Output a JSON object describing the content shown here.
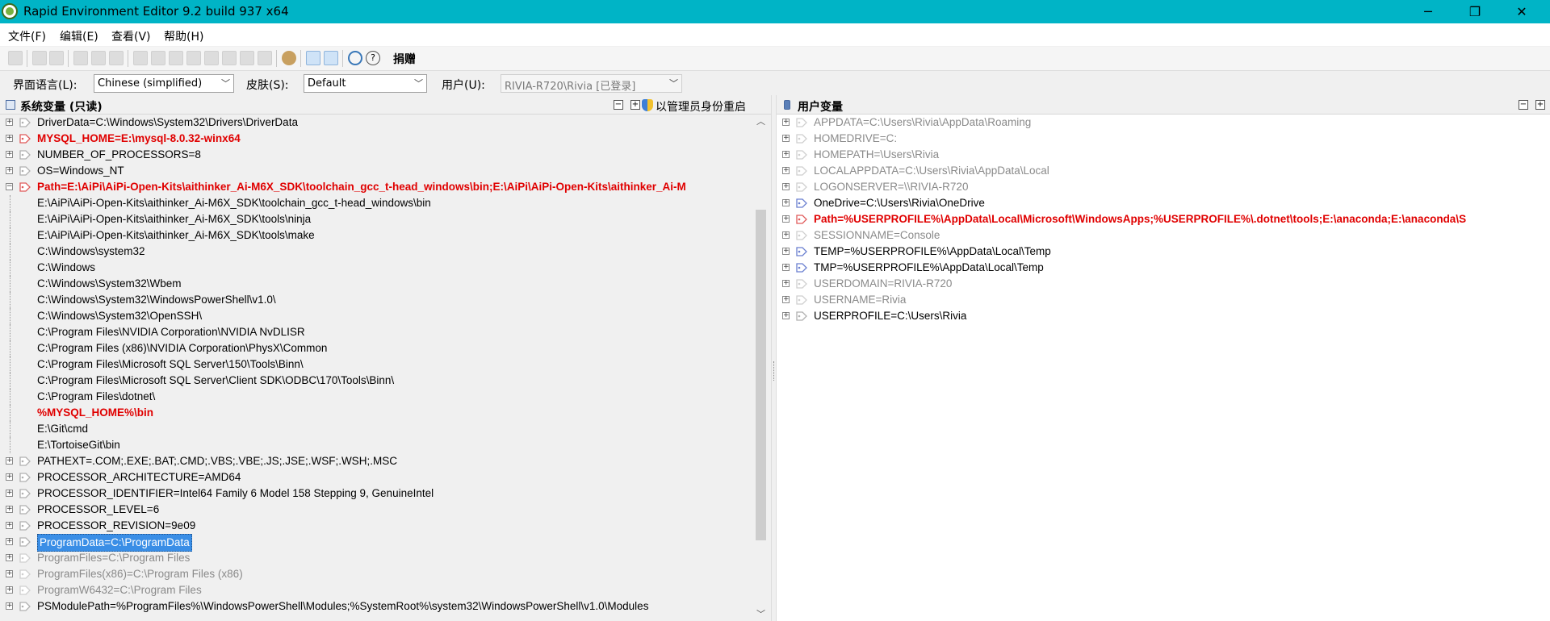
{
  "window": {
    "title": "Rapid Environment Editor 9.2 build 937 x64",
    "controls": [
      "─",
      "❐",
      "✕"
    ]
  },
  "menu": [
    "文件(F)",
    "编辑(E)",
    "查看(V)",
    "帮助(H)"
  ],
  "toolbar": {
    "donate_label": "捐赠"
  },
  "options": {
    "language_label": "界面语言(L):",
    "language_value": "Chinese (simplified)",
    "skin_label": "皮肤(S):",
    "skin_value": "Default",
    "user_label": "用户(U):",
    "user_value": "RIVIA-R720\\Rivia [已登录]"
  },
  "system_panel": {
    "title": "系统变量 (只读)",
    "admin_restart": "以管理员身份重启",
    "rows": [
      {
        "text": "DriverData=C:\\Windows\\System32\\Drivers\\DriverData",
        "level": 0,
        "style": "normal",
        "icon": "tag"
      },
      {
        "text": "MYSQL_HOME=E:\\mysql-8.0.32-winx64",
        "level": 0,
        "style": "red",
        "icon": "tag-red"
      },
      {
        "text": "NUMBER_OF_PROCESSORS=8",
        "level": 0,
        "style": "normal",
        "icon": "tag"
      },
      {
        "text": "OS=Windows_NT",
        "level": 0,
        "style": "normal",
        "icon": "tag"
      },
      {
        "text": "Path=E:\\AiPi\\AiPi-Open-Kits\\aithinker_Ai-M6X_SDK\\toolchain_gcc_t-head_windows\\bin;E:\\AiPi\\AiPi-Open-Kits\\aithinker_Ai-M",
        "level": 0,
        "style": "red",
        "icon": "tag-red",
        "expanded": true
      },
      {
        "text": "E:\\AiPi\\AiPi-Open-Kits\\aithinker_Ai-M6X_SDK\\toolchain_gcc_t-head_windows\\bin",
        "level": 1,
        "style": "normal"
      },
      {
        "text": "E:\\AiPi\\AiPi-Open-Kits\\aithinker_Ai-M6X_SDK\\tools\\ninja",
        "level": 1,
        "style": "normal"
      },
      {
        "text": "E:\\AiPi\\AiPi-Open-Kits\\aithinker_Ai-M6X_SDK\\tools\\make",
        "level": 1,
        "style": "normal"
      },
      {
        "text": "C:\\Windows\\system32",
        "level": 1,
        "style": "normal"
      },
      {
        "text": "C:\\Windows",
        "level": 1,
        "style": "normal"
      },
      {
        "text": "C:\\Windows\\System32\\Wbem",
        "level": 1,
        "style": "normal"
      },
      {
        "text": "C:\\Windows\\System32\\WindowsPowerShell\\v1.0\\",
        "level": 1,
        "style": "normal"
      },
      {
        "text": "C:\\Windows\\System32\\OpenSSH\\",
        "level": 1,
        "style": "normal"
      },
      {
        "text": "C:\\Program Files\\NVIDIA Corporation\\NVIDIA NvDLISR",
        "level": 1,
        "style": "normal"
      },
      {
        "text": "C:\\Program Files (x86)\\NVIDIA Corporation\\PhysX\\Common",
        "level": 1,
        "style": "normal"
      },
      {
        "text": "C:\\Program Files\\Microsoft SQL Server\\150\\Tools\\Binn\\",
        "level": 1,
        "style": "normal"
      },
      {
        "text": "C:\\Program Files\\Microsoft SQL Server\\Client SDK\\ODBC\\170\\Tools\\Binn\\",
        "level": 1,
        "style": "normal"
      },
      {
        "text": "C:\\Program Files\\dotnet\\",
        "level": 1,
        "style": "normal"
      },
      {
        "text": "%MYSQL_HOME%\\bin",
        "level": 1,
        "style": "red"
      },
      {
        "text": "E:\\Git\\cmd",
        "level": 1,
        "style": "normal"
      },
      {
        "text": "E:\\TortoiseGit\\bin",
        "level": 1,
        "style": "normal"
      },
      {
        "text": "PATHEXT=.COM;.EXE;.BAT;.CMD;.VBS;.VBE;.JS;.JSE;.WSF;.WSH;.MSC",
        "level": 0,
        "style": "normal",
        "icon": "tag"
      },
      {
        "text": "PROCESSOR_ARCHITECTURE=AMD64",
        "level": 0,
        "style": "normal",
        "icon": "tag"
      },
      {
        "text": "PROCESSOR_IDENTIFIER=Intel64 Family 6 Model 158 Stepping 9, GenuineIntel",
        "level": 0,
        "style": "normal",
        "icon": "tag"
      },
      {
        "text": "PROCESSOR_LEVEL=6",
        "level": 0,
        "style": "normal",
        "icon": "tag"
      },
      {
        "text": "PROCESSOR_REVISION=9e09",
        "level": 0,
        "style": "normal",
        "icon": "tag"
      },
      {
        "text": "ProgramData=C:\\ProgramData",
        "level": 0,
        "style": "selected",
        "icon": "tag"
      },
      {
        "text": "ProgramFiles=C:\\Program Files",
        "level": 0,
        "style": "grey",
        "icon": "tag-grey"
      },
      {
        "text": "ProgramFiles(x86)=C:\\Program Files (x86)",
        "level": 0,
        "style": "grey",
        "icon": "tag-grey"
      },
      {
        "text": "ProgramW6432=C:\\Program Files",
        "level": 0,
        "style": "grey",
        "icon": "tag-grey"
      },
      {
        "text": "PSModulePath=%ProgramFiles%\\WindowsPowerShell\\Modules;%SystemRoot%\\system32\\WindowsPowerShell\\v1.0\\Modules",
        "level": 0,
        "style": "normal",
        "icon": "tag"
      }
    ]
  },
  "user_panel": {
    "title": "用户变量",
    "rows": [
      {
        "text": "APPDATA=C:\\Users\\Rivia\\AppData\\Roaming",
        "style": "grey",
        "icon": "tag-grey"
      },
      {
        "text": "HOMEDRIVE=C:",
        "style": "grey",
        "icon": "tag-grey"
      },
      {
        "text": "HOMEPATH=\\Users\\Rivia",
        "style": "grey",
        "icon": "tag-grey"
      },
      {
        "text": "LOCALAPPDATA=C:\\Users\\Rivia\\AppData\\Local",
        "style": "grey",
        "icon": "tag-grey"
      },
      {
        "text": "LOGONSERVER=\\\\RIVIA-R720",
        "style": "grey",
        "icon": "tag-grey"
      },
      {
        "text": "OneDrive=C:\\Users\\Rivia\\OneDrive",
        "style": "normal",
        "icon": "tag-blue"
      },
      {
        "text": "Path=%USERPROFILE%\\AppData\\Local\\Microsoft\\WindowsApps;%USERPROFILE%\\.dotnet\\tools;E:\\anaconda;E:\\anaconda\\S",
        "style": "red",
        "icon": "tag-red"
      },
      {
        "text": "SESSIONNAME=Console",
        "style": "grey",
        "icon": "tag-grey"
      },
      {
        "text": "TEMP=%USERPROFILE%\\AppData\\Local\\Temp",
        "style": "normal",
        "icon": "tag-blue"
      },
      {
        "text": "TMP=%USERPROFILE%\\AppData\\Local\\Temp",
        "style": "normal",
        "icon": "tag-blue"
      },
      {
        "text": "USERDOMAIN=RIVIA-R720",
        "style": "grey",
        "icon": "tag-grey"
      },
      {
        "text": "USERNAME=Rivia",
        "style": "grey",
        "icon": "tag-grey"
      },
      {
        "text": "USERPROFILE=C:\\Users\\Rivia",
        "style": "normal",
        "icon": "tag"
      }
    ]
  },
  "colors": {
    "titlebar": "#00b4c6",
    "red_text": "#e00000",
    "grey_text": "#8a8a8a",
    "selection": "#3a8ee6"
  }
}
